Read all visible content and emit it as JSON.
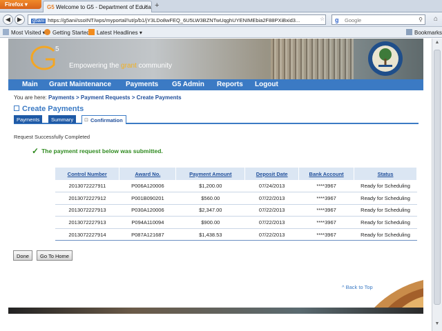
{
  "browser": {
    "menu_label": "Firefox",
    "tab_title": "Welcome to G5 - Department of Educati...",
    "tab_favicon": "G5",
    "new_tab_label": "+",
    "url_site_label": "g5ani",
    "url": "https://g5ani/ssoINT/wps/myportal/!ut/p/b1/jY3LDo8wFEQ_6U5LW3BZNTwUqghUYENIMEbia2F88PXiBxid3...",
    "search_placeholder": "Google",
    "bookmarks": [
      "Most Visited",
      "Getting Started",
      "Latest Headlines"
    ],
    "bookmarks_menu_label": "Bookmarks"
  },
  "banner": {
    "logo_text": "G5",
    "tagline_before": "Empowering the ",
    "tagline_highlight": "grant",
    "tagline_after": " community",
    "brand_color": "#f4b120"
  },
  "nav": {
    "items": [
      "Main",
      "Grant Maintenance",
      "Payments",
      "G5 Admin",
      "Reports",
      "Logout"
    ],
    "color": "#3b7ac4"
  },
  "breadcrumb": {
    "prefix": "You are here:",
    "items": [
      "Payments",
      "Payment Requests",
      "Create Payments"
    ],
    "separator": ">"
  },
  "page": {
    "title": "Create Payments",
    "tabs": [
      "Payments",
      "Summary",
      "Confirmation"
    ],
    "active_tab": "Confirmation",
    "status_text": "Request Successfully Completed",
    "success_message": "The payment request below was submitted."
  },
  "table": {
    "headers": [
      "Control Number",
      "Award No.",
      "Payment Amount",
      "Deposit Date",
      "Bank Account",
      "Status"
    ],
    "rows": [
      [
        "2013072227911",
        "P006A120006",
        "$1,200.00",
        "07/24/2013",
        "****3967",
        "Ready for Scheduling"
      ],
      [
        "2013072227912",
        "P001B090201",
        "$560.00",
        "07/22/2013",
        "****3967",
        "Ready for Scheduling"
      ],
      [
        "2013072227913",
        "P030A120006",
        "$2,347.00",
        "07/22/2013",
        "****3967",
        "Ready for Scheduling"
      ],
      [
        "2013072227913",
        "P094A110094",
        "$900.00",
        "07/22/2013",
        "****3967",
        "Ready for Scheduling"
      ],
      [
        "2013072227914",
        "P087A121687",
        "$1,438.53",
        "07/22/2013",
        "****3967",
        "Ready for Scheduling"
      ]
    ]
  },
  "buttons": {
    "done": "Done",
    "go_home": "Go To Home"
  },
  "back_to_top": "^ Back to Top",
  "icons": {
    "back": "back-arrow-icon",
    "forward": "forward-arrow-icon",
    "star": "bookmark-star-icon",
    "search": "search-icon",
    "home": "home-icon",
    "check": "check-icon",
    "seal": "department-seal-icon"
  }
}
